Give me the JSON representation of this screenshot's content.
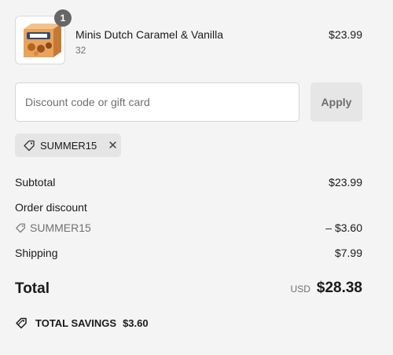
{
  "cart": {
    "item": {
      "name": "Minis Dutch Caramel & Vanilla",
      "variant": "32",
      "price": "$23.99",
      "quantity": "1",
      "image_icon": "product-box-image"
    }
  },
  "discount": {
    "placeholder": "Discount code or gift card",
    "apply_label": "Apply",
    "applied_code": "SUMMER15",
    "remove_icon": "close-icon"
  },
  "summary": {
    "subtotal_label": "Subtotal",
    "subtotal_value": "$23.99",
    "order_discount_label": "Order discount",
    "discount_code": "SUMMER15",
    "discount_value": "– $3.60",
    "shipping_label": "Shipping",
    "shipping_value": "$7.99",
    "total_label": "Total",
    "currency": "USD",
    "total_value": "$28.38",
    "savings_label": "TOTAL SAVINGS",
    "savings_value": "$3.60"
  }
}
